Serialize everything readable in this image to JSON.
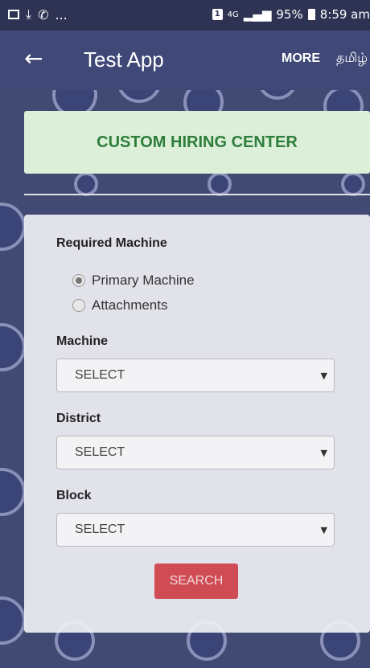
{
  "status_bar": {
    "left_icons": [
      "image-icon",
      "download-icon",
      "phone-icon"
    ],
    "ellipsis": "...",
    "badge": "1",
    "network": "4G",
    "battery": "95%",
    "time": "8:59 am"
  },
  "app_bar": {
    "title": "Test App",
    "more_label": "MORE",
    "language_label": "தமிழ்"
  },
  "header": {
    "title": "CUSTOM HIRING CENTER"
  },
  "form": {
    "required_machine_label": "Required Machine",
    "radio_options": [
      {
        "label": "Primary Machine",
        "selected": true
      },
      {
        "label": "Attachments",
        "selected": false
      }
    ],
    "machine_label": "Machine",
    "machine_value": "SELECT",
    "district_label": "District",
    "district_value": "SELECT",
    "block_label": "Block",
    "block_value": "SELECT",
    "search_label": "SEARCH"
  },
  "colors": {
    "background": "#414a73",
    "app_bar": "#3f4877",
    "header_card": "#dcefd8",
    "header_text": "#2e7d3b",
    "search_button": "#d04c55"
  }
}
